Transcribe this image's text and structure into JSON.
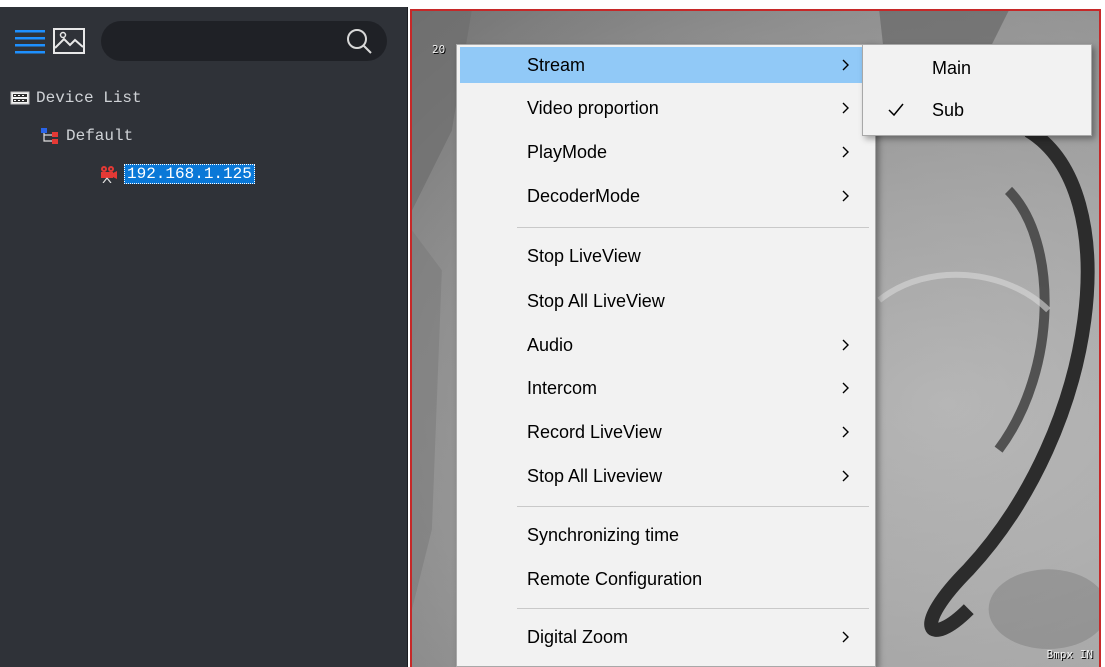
{
  "colors": {
    "panel_bg": "#2f3238",
    "selection": "#0a78d7",
    "menu_highlight": "#91c9f7",
    "video_border": "#c62828",
    "toolbar_icon": "#1e90ff"
  },
  "toolbar": {
    "icons": [
      "list-view-icon",
      "image-view-icon",
      "search-icon"
    ],
    "search_placeholder": ""
  },
  "device_tree": {
    "root_label": "Device List",
    "group_label": "Default",
    "device_label": "192.168.1.125"
  },
  "video": {
    "osd_top": "20",
    "osd_bottom": "Bmpx IN"
  },
  "context_menu": {
    "items": [
      {
        "label": "Stream",
        "has_submenu": true,
        "highlighted": true
      },
      {
        "label": "Video proportion",
        "has_submenu": true
      },
      {
        "label": "PlayMode",
        "has_submenu": true
      },
      {
        "label": "DecoderMode",
        "has_submenu": true
      },
      {
        "label": "Stop LiveView",
        "has_submenu": false
      },
      {
        "label": "Stop All LiveView",
        "has_submenu": false
      },
      {
        "label": "Audio",
        "has_submenu": true
      },
      {
        "label": "Intercom",
        "has_submenu": true
      },
      {
        "label": "Record LiveView",
        "has_submenu": true
      },
      {
        "label": "Stop All Liveview",
        "has_submenu": true
      },
      {
        "label": "Synchronizing time",
        "has_submenu": false
      },
      {
        "label": "Remote Configuration",
        "has_submenu": false
      },
      {
        "label": "Digital Zoom",
        "has_submenu": true
      }
    ]
  },
  "stream_submenu": {
    "items": [
      {
        "label": "Main",
        "checked": false
      },
      {
        "label": "Sub",
        "checked": true
      }
    ]
  }
}
